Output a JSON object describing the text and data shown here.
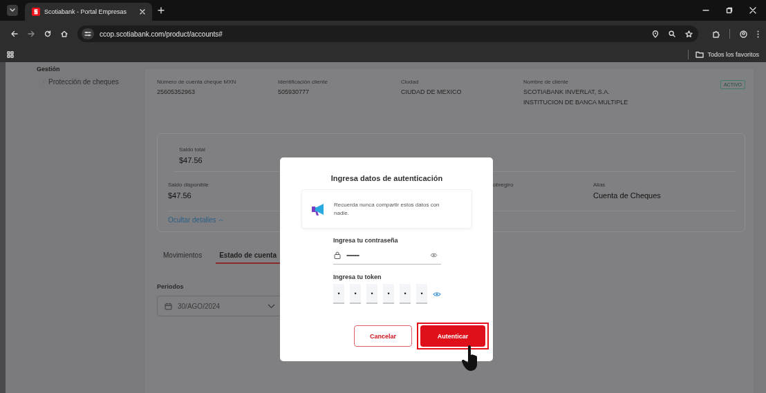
{
  "browser": {
    "tab": {
      "title": "Scotiabank - Portal Empresas",
      "selected": true
    },
    "url": "ccop.scotiabank.com/product/accounts#",
    "bookmarks": [
      "Todos los favoritos"
    ]
  },
  "sidebar": {
    "heading": "Gestión",
    "items": [
      {
        "label": "Protección de cheques"
      }
    ]
  },
  "account": {
    "fields": [
      {
        "label": "Número de cuenta cheque MXN",
        "lines": [
          "25605352963"
        ]
      },
      {
        "label": "Identificación cliente",
        "lines": [
          "505930777"
        ]
      },
      {
        "label": "Ciudad",
        "lines": [
          "CIUDAD DE MEXICO"
        ]
      },
      {
        "label": "Nombre de cliente",
        "lines": [
          "SCOTIABANK INVERLAT, S.A.",
          "INSTITUCION DE BANCA MULTIPLE"
        ]
      }
    ],
    "status": "ACTIVO"
  },
  "balances": {
    "rows": [
      {
        "fields": [
          {
            "label": "Saldo total",
            "value": "$47.56"
          }
        ]
      },
      {
        "fields": [
          {
            "label": "Saldo disponible",
            "value": "$47.56"
          },
          {
            "label": "obregiro"
          },
          {
            "label": "Alias",
            "value": "Cuenta de Cheques"
          }
        ]
      }
    ],
    "toggle": "Ocultar detalles"
  },
  "tabs": [
    {
      "label": "Movimientos",
      "selected": false
    },
    {
      "label": "Estado de cuenta",
      "selected": true
    }
  ],
  "period": {
    "label": "Periodos",
    "value": "30/AGO/2024"
  },
  "dialog": {
    "title": "Ingresa datos de autenticación",
    "notice": "Recuerda nunca compartir estos datos con nadie.",
    "password": {
      "label": "Ingresa tu contraseña",
      "value": "••••••••••"
    },
    "token": {
      "label": "Ingresa tu token",
      "digits": [
        "•",
        "•",
        "•",
        "•",
        "•",
        "•"
      ]
    },
    "buttons": [
      {
        "label": "Cancelar",
        "kind": "secondary",
        "highlighted": false
      },
      {
        "label": "Autenticar",
        "kind": "primary",
        "highlighted": true
      }
    ]
  }
}
